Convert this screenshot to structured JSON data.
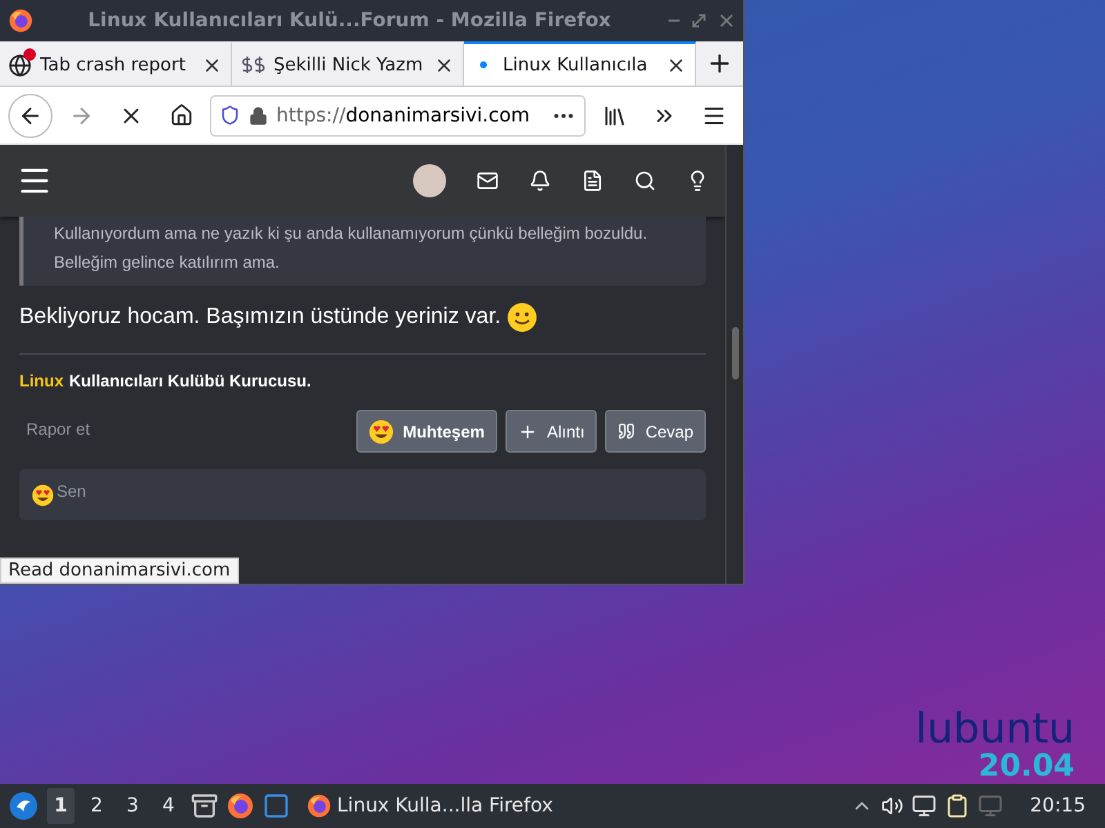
{
  "window": {
    "title": "Linux Kullanıcıları Kulü...Forum - Mozilla Firefox"
  },
  "tabs": [
    {
      "label": "Tab crash report",
      "kind": "crash",
      "selected": false
    },
    {
      "label": "Şekilli Nick Yazm",
      "kind": "dollar",
      "selected": false
    },
    {
      "label": "Linux Kullanıcıla",
      "kind": "loading",
      "selected": true
    }
  ],
  "url": {
    "scheme": "https://",
    "host": "donanimarsivi.com"
  },
  "post": {
    "quote_lines": [
      "Kullanıyordum ama ne yazık ki şu anda kullanamıyorum çünkü belleğim bozuldu.",
      "Belleğim gelince katılırım ama."
    ],
    "message": "Bekliyoruz hocam. Başımızın üstünde yeriniz var.",
    "signature": {
      "highlight": "Linux",
      "rest": "Kullanıcıları Kulübü Kurucusu."
    },
    "report": "Rapor et",
    "actions": [
      {
        "label": "Muhteşem",
        "kind": "reaction"
      },
      {
        "label": "Alıntı",
        "kind": "plus"
      },
      {
        "label": "Cevap",
        "kind": "quote"
      }
    ],
    "reacted_by": "Sen"
  },
  "status": "Read donanimarsivi.com",
  "taskbar": {
    "workspaces": [
      {
        "label": "1",
        "selected": true
      },
      {
        "label": "2",
        "selected": false
      },
      {
        "label": "3",
        "selected": false
      },
      {
        "label": "4",
        "selected": false
      }
    ],
    "task": "Linux Kulla...lla Firefox",
    "clock": "20:15"
  },
  "wallpaper": {
    "brand": "lubuntu",
    "version": "20.04"
  }
}
